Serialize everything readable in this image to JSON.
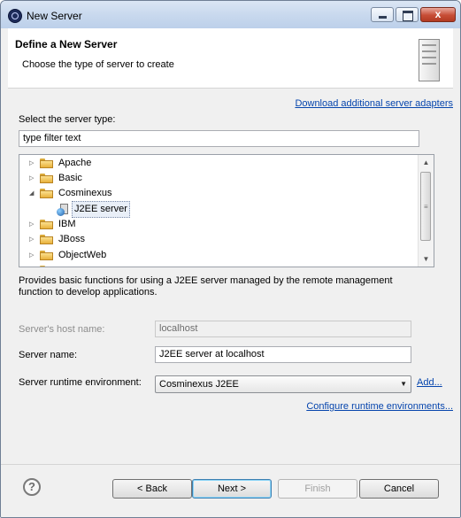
{
  "window": {
    "title": "New Server",
    "close_glyph": "x"
  },
  "header": {
    "title": "Define a New Server",
    "subtitle": "Choose the type of server to create",
    "image_icon": "server-icon"
  },
  "download_link": "Download additional server adapters",
  "server_type": {
    "label": "Select the server type:",
    "filter_value": "type filter text"
  },
  "tree": {
    "items": [
      {
        "label": "Apache",
        "expanded": false,
        "icon": "folder-icon"
      },
      {
        "label": "Basic",
        "expanded": false,
        "icon": "folder-icon"
      },
      {
        "label": "Cosminexus",
        "expanded": true,
        "icon": "folder-icon"
      },
      {
        "label": "J2EE server",
        "child": true,
        "selected": true,
        "icon": "j2ee-server-icon"
      },
      {
        "label": "IBM",
        "expanded": false,
        "icon": "folder-icon"
      },
      {
        "label": "JBoss",
        "expanded": false,
        "icon": "folder-icon"
      },
      {
        "label": "ObjectWeb",
        "expanded": false,
        "icon": "folder-icon"
      }
    ]
  },
  "description": "Provides basic functions for using a J2EE server managed by the remote management function to develop applications.",
  "host": {
    "label": "Server's host name:",
    "value": "localhost"
  },
  "server_name": {
    "label": "Server name:",
    "value": "J2EE server at localhost"
  },
  "runtime": {
    "label": "Server runtime environment:",
    "value": "Cosminexus J2EE",
    "add_link": "Add...",
    "configure_link": "Configure runtime environments..."
  },
  "footer": {
    "help_glyph": "?",
    "back": "< Back",
    "next": "Next >",
    "finish": "Finish",
    "cancel": "Cancel"
  }
}
